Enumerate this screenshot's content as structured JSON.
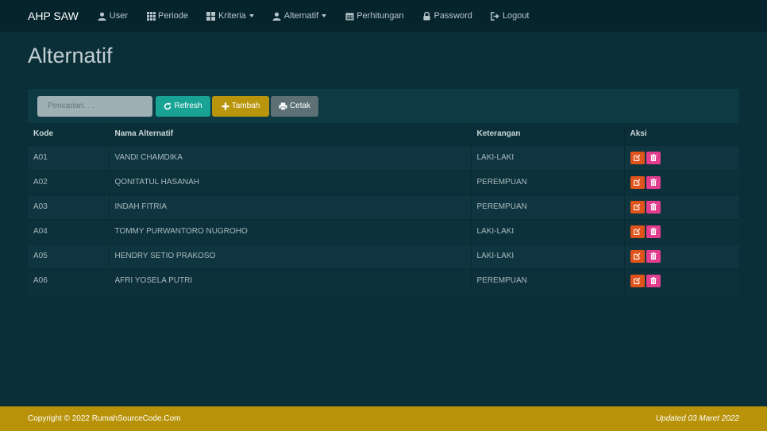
{
  "navbar": {
    "brand": "AHP SAW",
    "items": [
      {
        "label": "User",
        "icon": "user-icon"
      },
      {
        "label": "Periode",
        "icon": "grid-icon"
      },
      {
        "label": "Kriteria",
        "icon": "grid-large-icon",
        "dropdown": true
      },
      {
        "label": "Alternatif",
        "icon": "user-icon",
        "dropdown": true
      },
      {
        "label": "Perhitungan",
        "icon": "calendar-icon"
      },
      {
        "label": "Password",
        "icon": "lock-icon"
      },
      {
        "label": "Logout",
        "icon": "logout-icon"
      }
    ]
  },
  "page": {
    "title": "Alternatif"
  },
  "toolbar": {
    "search_placeholder": "Pencarian. . .",
    "refresh_label": "Refresh",
    "tambah_label": "Tambah",
    "cetak_label": "Cetak"
  },
  "table": {
    "headers": [
      "Kode",
      "Nama Alternatif",
      "Keterangan",
      "Aksi"
    ],
    "rows": [
      {
        "kode": "A01",
        "nama": "VANDI CHAMDIKA",
        "keterangan": "LAKI-LAKI"
      },
      {
        "kode": "A02",
        "nama": "QONITATUL HASANAH",
        "keterangan": "PEREMPUAN"
      },
      {
        "kode": "A03",
        "nama": "INDAH FITRIA",
        "keterangan": "PEREMPUAN"
      },
      {
        "kode": "A04",
        "nama": "TOMMY PURWANTORO NUGROHO",
        "keterangan": "LAKI-LAKI"
      },
      {
        "kode": "A05",
        "nama": "HENDRY SETIO PRAKOSO",
        "keterangan": "LAKI-LAKI"
      },
      {
        "kode": "A06",
        "nama": "AFRI YOSELA PUTRI",
        "keterangan": "PEREMPUAN"
      }
    ]
  },
  "footer": {
    "copyright": "Copyright © 2022 RumahSourceCode.Com",
    "updated": "Updated 03 Maret 2022"
  },
  "colors": {
    "background": "#0b2f38",
    "navbar": "#06242c",
    "refresh": "#19a394",
    "tambah": "#b8950c",
    "cetak": "#5d7075",
    "edit": "#e0541c",
    "delete": "#e23d8e",
    "footer": "#b8930a"
  }
}
